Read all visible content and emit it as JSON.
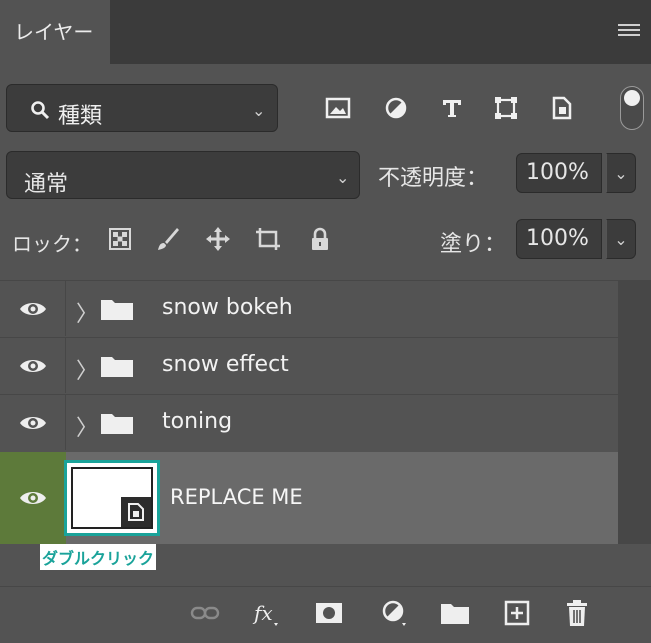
{
  "panel": {
    "tab_label": "レイヤー"
  },
  "filter": {
    "label": "種類"
  },
  "blend": {
    "mode": "通常",
    "opacity_label": "不透明度：",
    "opacity_value": "100%"
  },
  "lock": {
    "label": "ロック：",
    "fill_label": "塗り：",
    "fill_value": "100%"
  },
  "layers": [
    {
      "name": "snow bokeh",
      "type": "group",
      "visible": true
    },
    {
      "name": "snow effect",
      "type": "group",
      "visible": true
    },
    {
      "name": "toning",
      "type": "group",
      "visible": true
    },
    {
      "name": "REPLACE ME",
      "type": "smart-object",
      "visible": true,
      "selected": true
    }
  ],
  "callout": {
    "text": "ダブルクリック"
  },
  "colors": {
    "panel_bg": "#535353",
    "selected_row": "#6a6a6a",
    "visibility_active": "#5d7a3a",
    "highlight": "#1aa39a"
  }
}
